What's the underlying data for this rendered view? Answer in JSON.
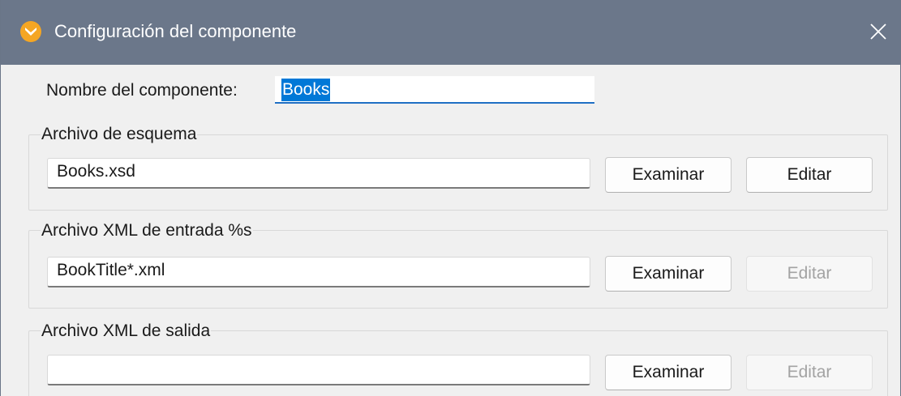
{
  "window": {
    "title": "Configuración del componente",
    "icon": "app-logo-icon",
    "close_icon": "close-icon"
  },
  "component_name": {
    "label": "Nombre del componente:",
    "value": "Books"
  },
  "schema_group": {
    "legend": "Archivo de esquema",
    "value": "Books.xsd",
    "browse_label": "Examinar",
    "edit_label": "Editar",
    "edit_enabled": true
  },
  "input_xml_group": {
    "legend": "Archivo XML de entrada %s",
    "value": "BookTitle*.xml",
    "browse_label": "Examinar",
    "edit_label": "Editar",
    "edit_enabled": false
  },
  "output_xml_group": {
    "legend": "Archivo XML de salida",
    "value": "",
    "browse_label": "Examinar",
    "edit_label": "Editar",
    "edit_enabled": false
  },
  "colors": {
    "titlebar": "#6b778a",
    "selection": "#0078d7",
    "logo": "#f5a623"
  }
}
